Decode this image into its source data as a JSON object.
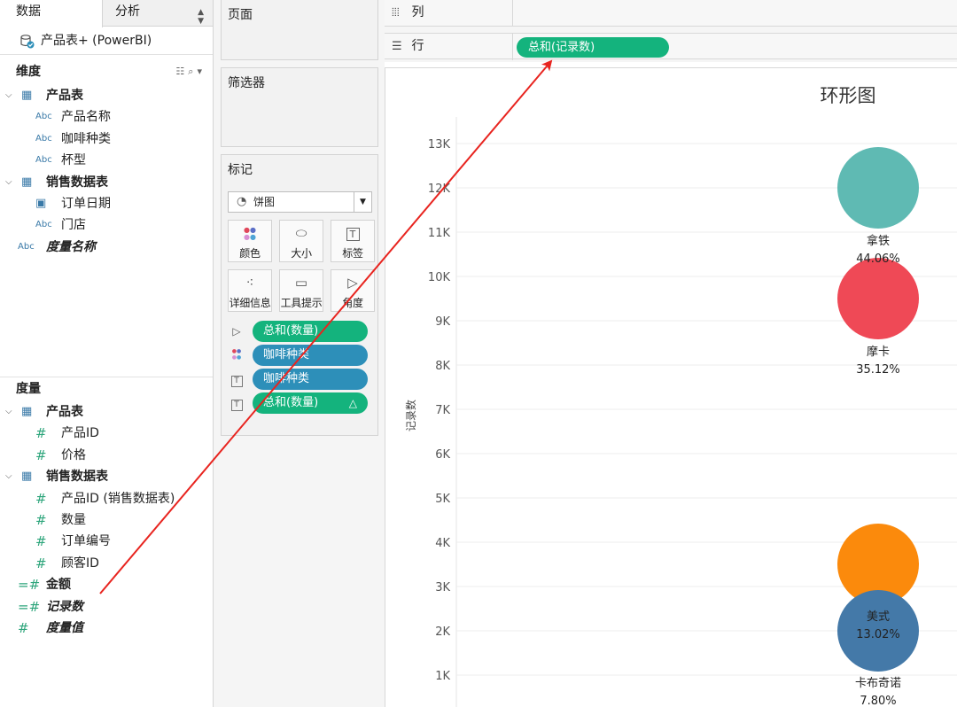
{
  "pane": {
    "tab_data": "数据",
    "tab_analysis": "分析",
    "datasource": "产品表+ (PowerBI)",
    "dimensions_header": "维度",
    "measures_header": "度量",
    "dimension_fields": [
      {
        "label": "产品表",
        "kind": "table",
        "level": 0,
        "style": "bold",
        "chevron": "⌄"
      },
      {
        "label": "产品名称",
        "kind": "abc",
        "level": 1,
        "style": "normal"
      },
      {
        "label": "咖啡种类",
        "kind": "abc",
        "level": 1,
        "style": "normal"
      },
      {
        "label": "杯型",
        "kind": "abc",
        "level": 1,
        "style": "normal"
      },
      {
        "label": "销售数据表",
        "kind": "table",
        "level": 0,
        "style": "bold",
        "chevron": "⌄"
      },
      {
        "label": "订单日期",
        "kind": "date",
        "level": 1,
        "style": "normal"
      },
      {
        "label": "门店",
        "kind": "abc",
        "level": 1,
        "style": "normal"
      },
      {
        "label": "度量名称",
        "kind": "abc",
        "level": -1,
        "style": "italic"
      }
    ],
    "measure_fields": [
      {
        "label": "产品表",
        "kind": "table",
        "level": 0,
        "style": "bold",
        "chevron": "⌄"
      },
      {
        "label": "产品ID",
        "kind": "num",
        "level": 1,
        "style": "normal"
      },
      {
        "label": "价格",
        "kind": "num",
        "level": 1,
        "style": "normal"
      },
      {
        "label": "销售数据表",
        "kind": "table",
        "level": 0,
        "style": "bold",
        "chevron": "⌄"
      },
      {
        "label": "产品ID (销售数据表)",
        "kind": "num",
        "level": 1,
        "style": "normal"
      },
      {
        "label": "数量",
        "kind": "num",
        "level": 1,
        "style": "normal"
      },
      {
        "label": "订单编号",
        "kind": "num",
        "level": 1,
        "style": "normal"
      },
      {
        "label": "顾客ID",
        "kind": "num",
        "level": 1,
        "style": "normal"
      },
      {
        "label": "金额",
        "kind": "calcnum",
        "level": -1,
        "style": "bold"
      },
      {
        "label": "记录数",
        "kind": "calcnum",
        "level": -1,
        "style": "italic"
      },
      {
        "label": "度量值",
        "kind": "num",
        "level": -1,
        "style": "italic"
      }
    ]
  },
  "cards": {
    "pages": "页面",
    "filters": "筛选器",
    "marks": "标记",
    "mark_type": "饼图",
    "buttons": [
      {
        "label": "颜色",
        "icon": "color-icon"
      },
      {
        "label": "大小",
        "icon": "size-icon"
      },
      {
        "label": "标签",
        "icon": "label-icon"
      },
      {
        "label": "详细信息",
        "icon": "detail-icon"
      },
      {
        "label": "工具提示",
        "icon": "tooltip-icon"
      },
      {
        "label": "角度",
        "icon": "angle-icon"
      }
    ],
    "pills": [
      {
        "label": "总和(数量)",
        "icon": "angle-icon",
        "color": "green",
        "delta": ""
      },
      {
        "label": "咖啡种类",
        "icon": "color-icon",
        "color": "blue",
        "delta": ""
      },
      {
        "label": "咖啡种类",
        "icon": "label-icon",
        "color": "blue",
        "delta": ""
      },
      {
        "label": "总和(数量)",
        "icon": "label-icon",
        "color": "green",
        "delta": "△"
      }
    ]
  },
  "shelves": {
    "columns_label": "列",
    "rows_label": "行",
    "rows_pill": "总和(记录数)"
  },
  "colors": {
    "green_pill": "#14b37d",
    "blue_pill": "#2d8fb9",
    "annotation_arrow": "#e8241f"
  },
  "chart_data": {
    "type": "scatter",
    "title": "环形图",
    "ylabel": "记录数",
    "ylim": [
      0,
      13500
    ],
    "y_ticks": [
      1000,
      2000,
      3000,
      4000,
      5000,
      6000,
      7000,
      8000,
      9000,
      10000,
      11000,
      12000,
      13000
    ],
    "y_tick_labels": [
      "1K",
      "2K",
      "3K",
      "4K",
      "5K",
      "6K",
      "7K",
      "8K",
      "9K",
      "10K",
      "11K",
      "12K",
      "13K"
    ],
    "grid": true,
    "points": [
      {
        "name": "拿铁",
        "pct": "44.06%",
        "y": 12000,
        "color": "#5fbab3"
      },
      {
        "name": "摩卡",
        "pct": "35.12%",
        "y": 9500,
        "color": "#ef4956"
      },
      {
        "name": "美式",
        "pct": "13.02%",
        "y": 3500,
        "color": "#fb8a0c"
      },
      {
        "name": "卡布奇诺",
        "pct": "7.80%",
        "y": 2000,
        "color": "#4479a8"
      }
    ]
  }
}
